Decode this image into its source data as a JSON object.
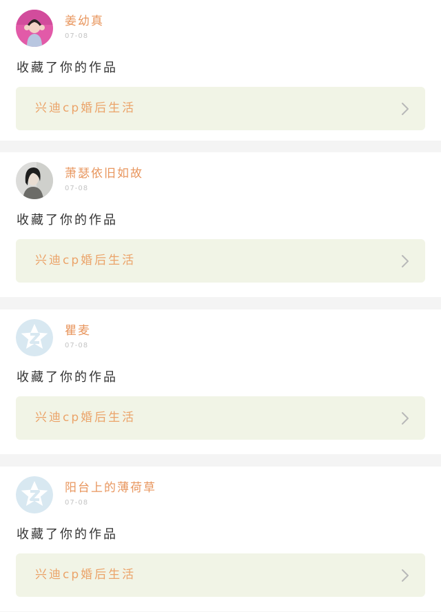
{
  "feed": {
    "items": [
      {
        "username": "姜幼真",
        "timestamp": "07-08",
        "action": "收藏了你的作品",
        "work_title": "兴迪cp婚后生活",
        "avatar": "photo-avatar-pink",
        "chevron": "chevron-right-icon"
      },
      {
        "username": "萧瑟依旧如故",
        "timestamp": "07-08",
        "action": "收藏了你的作品",
        "work_title": "兴迪cp婚后生活",
        "avatar": "photo-avatar-grey",
        "chevron": "chevron-right-icon"
      },
      {
        "username": "瞿麦",
        "timestamp": "07-08",
        "action": "收藏了你的作品",
        "work_title": "兴迪cp婚后生活",
        "avatar": "default-star-avatar",
        "chevron": "chevron-right-icon"
      },
      {
        "username": "阳台上的薄荷草",
        "timestamp": "07-08",
        "action": "收藏了你的作品",
        "work_title": "兴迪cp婚后生活",
        "avatar": "default-star-avatar",
        "chevron": "chevron-right-icon"
      }
    ]
  },
  "colors": {
    "username": "#e8965e",
    "work_title": "#eba369",
    "work_card_bg": "#f1f4e6",
    "separator": "#f4f4f4",
    "default_avatar": "#d8e8f1"
  }
}
